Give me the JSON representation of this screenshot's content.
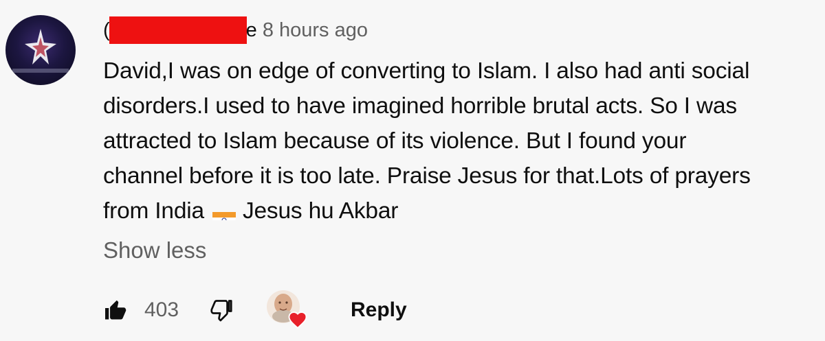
{
  "comment": {
    "author_prefix": "(",
    "author_suffix": "e",
    "timestamp": "8 hours ago",
    "lines": [
      "David,I was on edge of converting to Islam. I also had anti social",
      "disorders.I used to have imagined horrible brutal acts. So I was",
      "attracted to Islam because of its violence. But I found your",
      "channel before it is too late. Praise Jesus for that.Lots of prayers"
    ],
    "last_line_before_flag": "from India",
    "last_line_after_flag": "Jesus hu Akbar",
    "flag_emoji": "india-flag-icon",
    "show_less_label": "Show less"
  },
  "actions": {
    "like_icon": "thumbs-up-icon",
    "like_count": "403",
    "dislike_icon": "thumbs-down-icon",
    "creator_heart_icon": "creator-heart-avatar",
    "reply_label": "Reply"
  },
  "colors": {
    "background": "#f7f7f7",
    "text": "#0f0f0f",
    "secondary_text": "#606060",
    "redaction": "#ee1111",
    "heart": "#e8202a"
  }
}
